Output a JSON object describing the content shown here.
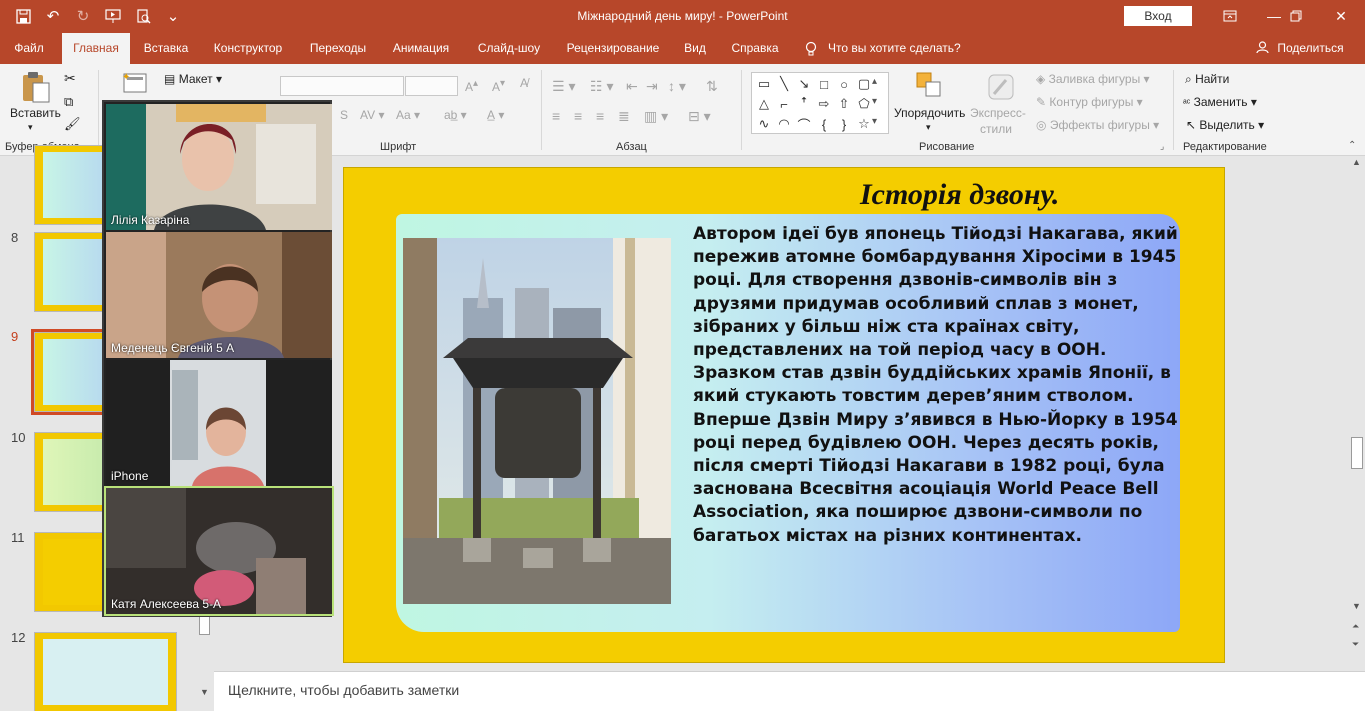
{
  "window": {
    "title": "Міжнародний день миру!  -  PowerPoint",
    "signin_label": "Вход"
  },
  "ribbon_tabs": [
    "Файл",
    "Главная",
    "Вставка",
    "Конструктор",
    "Переходы",
    "Анимация",
    "Слайд-шоу",
    "Рецензирование",
    "Вид",
    "Справка",
    "Что вы хотите сделать?"
  ],
  "active_tab": "Главная",
  "share_label": "Поделиться",
  "ribbon": {
    "groups": {
      "clipboard": "Буфер обмена",
      "font": "Шрифт",
      "paragraph": "Абзац",
      "drawing": "Рисование",
      "editing": "Редактирование"
    },
    "paste_label": "Вставить",
    "layout_label": "Макет",
    "arrange_label": "Упорядочить",
    "quick_styles_label_1": "Экспресс-",
    "quick_styles_label_2": "стили",
    "shape_fill_label": "Заливка фигуры",
    "shape_outline_label": "Контур фигуры",
    "shape_effects_label": "Эффекты фигуры",
    "find_label": "Найти",
    "replace_label": "Заменить",
    "select_label": "Выделить"
  },
  "slides": {
    "visible_numbers": [
      "8",
      "9",
      "10",
      "11",
      "12"
    ],
    "selected": "9"
  },
  "participants": [
    {
      "name": "Лілія Казаріна"
    },
    {
      "name": "Меденець Євгеній 5 А"
    },
    {
      "name": "iPhone"
    },
    {
      "name": "Катя Алексеева 5-А"
    }
  ],
  "slide": {
    "title": "Історія дзвону.",
    "body": "Автором ідеї був японець Тійодзі Накагава, який пережив атомне бомбардування Хіросіми в 1945 році. Для створення дзвонів-символів він з друзями придумав особливий сплав з монет, зібраних у більш ніж ста країнах світу, представлених на той період часу в ООН. Зразком став дзвін буддійських храмів Японії, в який стукають товстим дерев’яним стволом. Вперше Дзвін Миру з’явився в Нью-Йорку в 1954 році перед будівлею ООН. Через десять років, після смерті Тійодзі Накагави в 1982 році, була заснована Всесвітня асоціація World Peace Bell Association, яка поширює дзвони-символи по багатьох містах на різних континентах.",
    "image": "peace-bell-photo"
  },
  "notes_placeholder": "Щелкните, чтобы добавить заметки",
  "colors": {
    "accent": "#b7472a",
    "slide_background": "#f4cd00"
  }
}
